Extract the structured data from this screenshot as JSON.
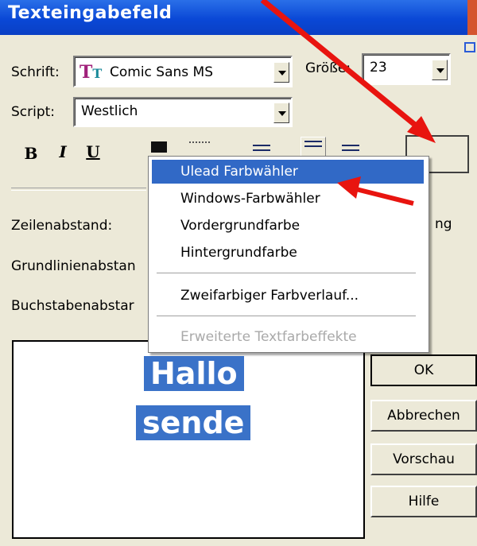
{
  "window": {
    "title": "Texteingabefeld"
  },
  "font": {
    "label": "Schrift:",
    "value": "Comic Sans MS",
    "icon": "truetype-font-icon"
  },
  "size": {
    "label": "Größe:",
    "value": "23"
  },
  "script": {
    "label": "Script:",
    "value": "Westlich"
  },
  "format_buttons": [
    "B",
    "I",
    "U"
  ],
  "spacing": {
    "line_label": "Zeilenabstand:",
    "baseline_label": "Grundlinienabstan",
    "letter_label": "Buchstabenabstar",
    "right_partial": "ng"
  },
  "preview": {
    "lines": [
      "Hallo",
      "sende"
    ]
  },
  "buttons": {
    "ok": "OK",
    "cancel": "Abbrechen",
    "preview": "Vorschau",
    "help": "Hilfe"
  },
  "context_menu": {
    "items": [
      {
        "label": "Ulead Farbwähler",
        "state": "selected"
      },
      {
        "label": "Windows-Farbwähler",
        "state": "normal"
      },
      {
        "label": "Vordergrundfarbe",
        "state": "normal"
      },
      {
        "label": "Hintergrundfarbe",
        "state": "normal"
      },
      {
        "label": "Zweifarbiger Farbverlauf...",
        "state": "normal"
      },
      {
        "label": "Erweiterte Textfarbeffekte",
        "state": "disabled"
      }
    ]
  },
  "colors": {
    "title_bar": "#0a48d6",
    "highlight": "#3169c6",
    "annotation_arrow": "#e8140f",
    "dialog_bg": "#ece9d8"
  }
}
